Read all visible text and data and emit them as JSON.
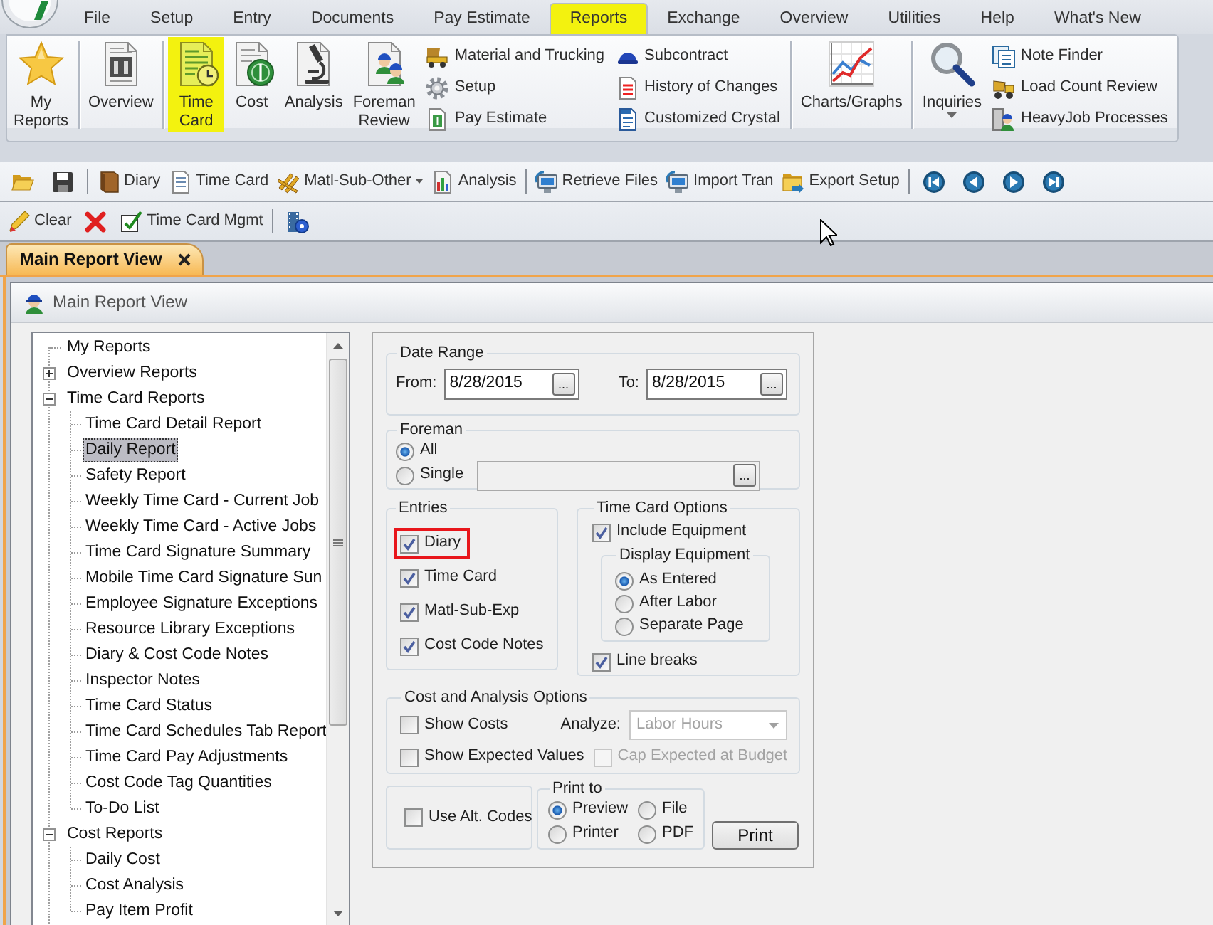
{
  "menu": {
    "tabs": [
      {
        "label": "File",
        "selected": false,
        "highlighted": false
      },
      {
        "label": "Setup",
        "selected": false,
        "highlighted": false
      },
      {
        "label": "Entry",
        "selected": false,
        "highlighted": false
      },
      {
        "label": "Documents",
        "selected": false,
        "highlighted": false
      },
      {
        "label": "Pay Estimate",
        "selected": false,
        "highlighted": false
      },
      {
        "label": "Reports",
        "selected": true,
        "highlighted": true
      },
      {
        "label": "Exchange",
        "selected": false,
        "highlighted": false
      },
      {
        "label": "Overview",
        "selected": false,
        "highlighted": false
      },
      {
        "label": "Utilities",
        "selected": false,
        "highlighted": false
      },
      {
        "label": "Help",
        "selected": false,
        "highlighted": false
      },
      {
        "label": "What's New",
        "selected": false,
        "highlighted": false
      }
    ]
  },
  "ribbon": {
    "items": [
      {
        "kind": "large",
        "label": "My Reports",
        "highlighted": false
      },
      {
        "kind": "separator"
      },
      {
        "kind": "large",
        "label": "Overview",
        "highlighted": false
      },
      {
        "kind": "separator"
      },
      {
        "kind": "large",
        "label": "Time Card",
        "highlighted": true
      },
      {
        "kind": "large",
        "label": "Cost",
        "highlighted": false
      },
      {
        "kind": "large",
        "label": "Analysis",
        "highlighted": false
      },
      {
        "kind": "large",
        "label": "Foreman Review",
        "highlighted": false
      },
      {
        "kind": "stack",
        "items": [
          {
            "label": "Material and Trucking"
          },
          {
            "label": "Setup"
          },
          {
            "label": "Pay Estimate"
          }
        ]
      },
      {
        "kind": "stack",
        "items": [
          {
            "label": "Subcontract"
          },
          {
            "label": "History of Changes"
          },
          {
            "label": "Customized Crystal"
          }
        ]
      },
      {
        "kind": "separator"
      },
      {
        "kind": "large",
        "label": "Charts/Graphs",
        "highlighted": false
      },
      {
        "kind": "separator"
      },
      {
        "kind": "large",
        "label": "Inquiries",
        "highlighted": false,
        "dropdown": true
      },
      {
        "kind": "stack",
        "items": [
          {
            "label": "Note Finder"
          },
          {
            "label": "Load Count Review"
          },
          {
            "label": "HeavyJob Processes"
          }
        ]
      }
    ]
  },
  "toolbars": [
    {
      "items": [
        {
          "kind": "icon"
        },
        {
          "kind": "icon"
        },
        {
          "kind": "separator"
        },
        {
          "kind": "button",
          "label": "Diary"
        },
        {
          "kind": "button",
          "label": "Time Card"
        },
        {
          "kind": "button",
          "label": "Matl-Sub-Other",
          "dropdown": true
        },
        {
          "kind": "button",
          "label": "Analysis"
        },
        {
          "kind": "separator"
        },
        {
          "kind": "button",
          "label": "Retrieve Files"
        },
        {
          "kind": "button",
          "label": "Import Tran"
        },
        {
          "kind": "button",
          "label": "Export Setup"
        },
        {
          "kind": "separator"
        },
        {
          "kind": "icon"
        },
        {
          "kind": "icon"
        },
        {
          "kind": "icon"
        },
        {
          "kind": "icon"
        }
      ]
    },
    {
      "items": [
        {
          "kind": "button",
          "label": "Clear"
        },
        {
          "kind": "icon"
        },
        {
          "kind": "button",
          "label": "Time Card Mgmt"
        },
        {
          "kind": "separator"
        },
        {
          "kind": "icon"
        }
      ]
    }
  ],
  "document_tabs": [
    {
      "label": "Main Report View",
      "selected": true
    }
  ],
  "report_window": {
    "title": "Main Report View",
    "tree": [
      {
        "label": "My Reports",
        "selected": false
      },
      {
        "label": "Overview Reports",
        "expanded": false,
        "selected": false
      },
      {
        "label": "Time Card Reports",
        "expanded": true,
        "selected": false,
        "children": [
          {
            "label": "Time Card Detail Report",
            "selected": false
          },
          {
            "label": "Daily Report",
            "selected": true
          },
          {
            "label": "Safety Report",
            "selected": false
          },
          {
            "label": "Weekly Time Card - Current Job",
            "selected": false
          },
          {
            "label": "Weekly Time Card - Active Jobs",
            "selected": false
          },
          {
            "label": "Time Card Signature Summary",
            "selected": false
          },
          {
            "label": "Mobile Time Card Signature Sun",
            "selected": false
          },
          {
            "label": "Employee Signature Exceptions",
            "selected": false
          },
          {
            "label": "Resource Library Exceptions",
            "selected": false
          },
          {
            "label": "Diary & Cost Code Notes",
            "selected": false
          },
          {
            "label": "Inspector Notes",
            "selected": false
          },
          {
            "label": "Time Card Status",
            "selected": false
          },
          {
            "label": "Time Card Schedules Tab Report",
            "selected": false
          },
          {
            "label": "Time Card Pay Adjustments",
            "selected": false
          },
          {
            "label": "Cost Code Tag Quantities",
            "selected": false
          },
          {
            "label": "To-Do List",
            "selected": false
          }
        ]
      },
      {
        "label": "Cost Reports",
        "expanded": true,
        "selected": false,
        "children": [
          {
            "label": "Daily Cost",
            "selected": false
          },
          {
            "label": "Cost Analysis",
            "selected": false
          },
          {
            "label": "Pay Item Profit",
            "selected": false
          }
        ]
      }
    ],
    "form": {
      "date_range": {
        "title": "Date Range",
        "from": {
          "label": "From:",
          "value": "8/28/2015",
          "button": "..."
        },
        "to": {
          "label": "To:",
          "value": "8/28/2015",
          "button": "..."
        }
      },
      "foreman": {
        "title": "Foreman",
        "options": [
          {
            "label": "All",
            "selected": true
          },
          {
            "label": "Single",
            "selected": false
          }
        ],
        "field": {
          "disabled": true,
          "button": "..."
        }
      },
      "entries": {
        "title": "Entries",
        "options": [
          {
            "label": "Diary",
            "checked": true,
            "highlighted": true
          },
          {
            "label": "Time Card",
            "checked": true,
            "highlighted": false
          },
          {
            "label": "Matl-Sub-Exp",
            "checked": true,
            "highlighted": false
          },
          {
            "label": "Cost Code Notes",
            "checked": true,
            "highlighted": false
          }
        ]
      },
      "time_card_options": {
        "title": "Time Card Options",
        "include_equipment": {
          "label": "Include Equipment",
          "checked": true
        },
        "display_equipment": {
          "title": "Display Equipment",
          "options": [
            {
              "label": "As Entered",
              "selected": true
            },
            {
              "label": "After Labor",
              "selected": false
            },
            {
              "label": "Separate Page",
              "selected": false
            }
          ]
        },
        "line_breaks": {
          "label": "Line breaks",
          "checked": true
        }
      },
      "cost_analysis": {
        "title": "Cost and Analysis Options",
        "show_costs": {
          "label": "Show Costs",
          "checked": false
        },
        "analyze": {
          "label": "Analyze:",
          "value": "Labor Hours",
          "disabled": true
        },
        "show_expected": {
          "label": "Show Expected Values",
          "checked": false
        },
        "cap_expected": {
          "label": "Cap Expected at Budget",
          "checked": false,
          "disabled": true
        }
      },
      "use_alt_codes": {
        "label": "Use Alt. Codes",
        "checked": false
      },
      "print_to": {
        "title": "Print to",
        "options": [
          {
            "label": "Preview",
            "selected": true
          },
          {
            "label": "File",
            "selected": false
          },
          {
            "label": "Printer",
            "selected": false
          },
          {
            "label": "PDF",
            "selected": false
          }
        ]
      },
      "print_button": "Print"
    }
  }
}
